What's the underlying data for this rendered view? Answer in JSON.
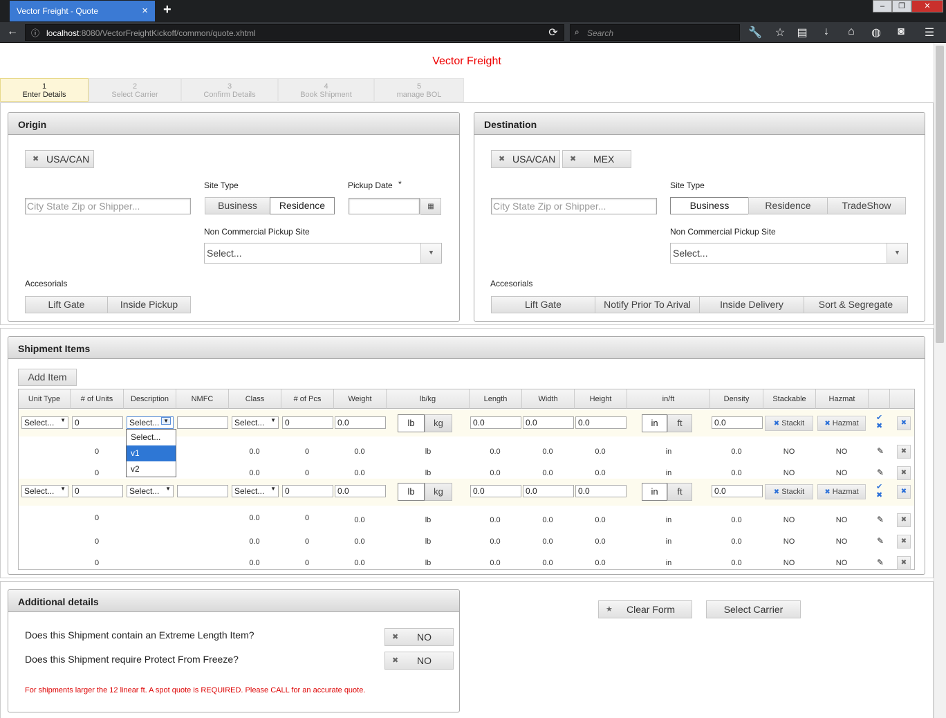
{
  "browser": {
    "tab_title": "Vector Freight - Quote",
    "url_host": "localhost",
    "url_rest": ":8080/VectorFreightKickoff/common/quote.xhtml",
    "search_placeholder": "Search"
  },
  "brand": "Vector Freight",
  "steps": [
    {
      "num": "1",
      "label": "Enter Details"
    },
    {
      "num": "2",
      "label": "Select Carrier"
    },
    {
      "num": "3",
      "label": "Confirm Details"
    },
    {
      "num": "4",
      "label": "Book Shipment"
    },
    {
      "num": "5",
      "label": "manage BOL"
    }
  ],
  "origin": {
    "title": "Origin",
    "chips": [
      "USA/CAN"
    ],
    "city_placeholder": "City State Zip or Shipper...",
    "site_type_label": "Site Type",
    "site_types": [
      "Business",
      "Residence"
    ],
    "pickup_date_label": "Pickup Date",
    "required_mark": "*",
    "noncommercial_label": "Non Commercial Pickup Site",
    "noncommercial_value": "Select...",
    "accessorials_label": "Accesorials",
    "accessorials": [
      "Lift Gate",
      "Inside Pickup"
    ]
  },
  "destination": {
    "title": "Destination",
    "chips": [
      "USA/CAN",
      "MEX"
    ],
    "city_placeholder": "City State Zip or Shipper...",
    "site_type_label": "Site Type",
    "site_types": [
      "Business",
      "Residence",
      "TradeShow"
    ],
    "noncommercial_label": "Non Commercial Pickup Site",
    "noncommercial_value": "Select...",
    "accessorials_label": "Accesorials",
    "accessorials": [
      "Lift Gate",
      "Notify Prior To Arival",
      "Inside Delivery",
      "Sort & Segregate"
    ]
  },
  "shipment": {
    "title": "Shipment Items",
    "add_item": "Add Item",
    "columns": [
      "Unit Type",
      "# of Units",
      "Description",
      "NMFC",
      "Class",
      "# of Pcs",
      "Weight",
      "lb/kg",
      "Length",
      "Width",
      "Height",
      "in/ft",
      "Density",
      "Stackable",
      "Hazmat"
    ],
    "edit": {
      "select": "Select...",
      "units": "0",
      "weight": "0.0",
      "length": "0.0",
      "width": "0.0",
      "height": "0.0",
      "density": "0.0",
      "lb": "lb",
      "kg": "kg",
      "in": "in",
      "ft": "ft",
      "stackit": "Stackit",
      "hazmat": "Hazmat"
    },
    "dropdown_options": [
      "Select...",
      "v1",
      "v2"
    ],
    "group1_rows": [
      {
        "units": "0",
        "class": "0.0",
        "pcs": "0",
        "weight": "0.0",
        "lbkg": "lb",
        "length": "0.0",
        "width": "0.0",
        "height": "0.0",
        "inft": "in",
        "density": "0.0",
        "stackable": "NO",
        "hazmat": "NO"
      },
      {
        "units": "0",
        "class": "0.0",
        "pcs": "0",
        "weight": "0.0",
        "lbkg": "lb",
        "length": "0.0",
        "width": "0.0",
        "height": "0.0",
        "inft": "in",
        "density": "0.0",
        "stackable": "NO",
        "hazmat": "NO"
      }
    ],
    "group2_rows": [
      {
        "units": "0",
        "class": "0.0",
        "pcs": "0",
        "weight": "0.0",
        "lbkg": "lb",
        "length": "0.0",
        "width": "0.0",
        "height": "0.0",
        "inft": "in",
        "density": "0.0",
        "stackable": "NO",
        "hazmat": "NO"
      },
      {
        "units": "0",
        "class": "0.0",
        "pcs": "0",
        "weight": "0.0",
        "lbkg": "lb",
        "length": "0.0",
        "width": "0.0",
        "height": "0.0",
        "inft": "in",
        "density": "0.0",
        "stackable": "NO",
        "hazmat": "NO"
      },
      {
        "units": "0",
        "class": "0.0",
        "pcs": "0",
        "weight": "0.0",
        "lbkg": "lb",
        "length": "0.0",
        "width": "0.0",
        "height": "0.0",
        "inft": "in",
        "density": "0.0",
        "stackable": "NO",
        "hazmat": "NO"
      }
    ]
  },
  "additional": {
    "title": "Additional details",
    "q1": "Does this Shipment contain an Extreme Length Item?",
    "q1_value": "NO",
    "q2": "Does this Shipment require Protect From Freeze?",
    "q2_value": "NO",
    "note": "For shipments larger the 12 linear ft. A spot quote is REQUIRED. Please CALL for an accurate quote."
  },
  "actions": {
    "clear": "Clear Form",
    "select_carrier": "Select Carrier"
  },
  "colors": {
    "brand": "#e00000",
    "accent": "#2e77d5",
    "tab": "#3b7ad4"
  }
}
